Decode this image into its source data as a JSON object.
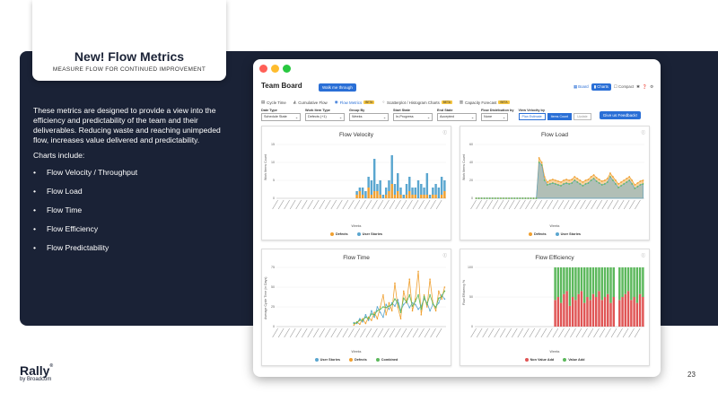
{
  "slide": {
    "title": "New! Flow Metrics",
    "subtitle": "MEASURE FLOW FOR CONTINUED IMPROVEMENT",
    "intro": "These metrics are designed to provide a view into the efficiency and predictability of the team and their deliverables. Reducing waste and reaching unimpeded flow, increases value delivered and predictability.",
    "charts_include": "Charts include:",
    "bullets": [
      "Flow Velocity / Throughput",
      "Flow Load",
      "Flow Time",
      "Flow Efficiency",
      "Flow Predictability"
    ],
    "logo": "Rally",
    "logo_mark": "®",
    "logo_by": "by Broadcom",
    "page_number": "23"
  },
  "colors": {
    "navy": "#1a2236",
    "accent": "#2a6fd6",
    "orange": "#f0a030",
    "blue": "#5aa6cf",
    "green": "#5cb85c",
    "red": "#e05555"
  },
  "app": {
    "window_dots": [
      "#ff5f57",
      "#febc2e",
      "#28c840"
    ],
    "title": "Team Board",
    "walk_button": "Walk me through",
    "view_board": "Board",
    "view_charts": "Charts",
    "view_compact": "Compact",
    "tabs": [
      {
        "icon": "cycle-time-icon",
        "label": "Cycle Time",
        "beta": ""
      },
      {
        "icon": "cumulative-flow-icon",
        "label": "Cumulative Flow",
        "beta": ""
      },
      {
        "icon": "flow-metrics-icon",
        "label": "Flow Metrics",
        "beta": "BETA"
      },
      {
        "icon": "scatterplot-icon",
        "label": "Scatterplot / Histogram Charts",
        "beta": "BETA"
      },
      {
        "icon": "capacity-icon",
        "label": "Capacity Forecast",
        "beta": "BETA"
      }
    ],
    "filters": {
      "date_type": {
        "label": "Date Type",
        "value": "Schedule State"
      },
      "work_item_type": {
        "label": "Work Item Type",
        "value": "Defects (+1)"
      },
      "group_by": {
        "label": "Group By",
        "value": "Weeks"
      },
      "start_state": {
        "label": "Start State",
        "value": "In-Progress"
      },
      "end_state": {
        "label": "End State",
        "value": "Accepted"
      },
      "flow_dist": {
        "label": "Flow Distribution by",
        "value": "None"
      },
      "view_velocity": {
        "label": "View Velocity by",
        "btn1": "Plan Estimate",
        "btn2": "Items Count",
        "update": "Update"
      }
    },
    "feedback_button": "Give us Feedback!"
  },
  "chart_data": [
    {
      "type": "bar",
      "title": "Flow Velocity",
      "xlabel": "Weeks",
      "ylabel": "Work Items Count",
      "ylim": [
        0,
        15
      ],
      "yticks": [
        "15",
        "10",
        "5",
        "0"
      ],
      "series": [
        {
          "name": "Defects",
          "color": "#f0a030",
          "values": [
            0,
            0,
            0,
            0,
            0,
            0,
            0,
            0,
            0,
            0,
            0,
            0,
            0,
            0,
            0,
            0,
            0,
            0,
            0,
            0,
            0,
            0,
            0,
            0,
            0,
            0,
            0,
            1,
            2,
            1,
            0,
            3,
            1,
            2,
            2,
            1,
            0,
            1,
            2,
            4,
            1,
            2,
            1,
            0,
            1,
            2,
            1,
            1,
            0,
            1,
            1,
            1,
            0,
            1,
            1,
            0,
            1,
            2
          ]
        },
        {
          "name": "User Stories",
          "color": "#5aa6cf",
          "values": [
            0,
            0,
            0,
            0,
            0,
            0,
            0,
            0,
            0,
            0,
            0,
            0,
            0,
            0,
            0,
            0,
            0,
            0,
            0,
            0,
            0,
            0,
            0,
            0,
            0,
            0,
            0,
            1,
            1,
            2,
            2,
            3,
            4,
            9,
            2,
            4,
            1,
            2,
            3,
            8,
            3,
            5,
            2,
            1,
            3,
            4,
            2,
            2,
            5,
            3,
            2,
            6,
            1,
            2,
            3,
            3,
            5,
            3
          ]
        }
      ]
    },
    {
      "type": "area",
      "title": "Flow Load",
      "xlabel": "Weeks",
      "ylabel": "Work Items Count",
      "ylim": [
        0,
        60
      ],
      "yticks": [
        "60",
        "40",
        "20",
        "0"
      ],
      "series": [
        {
          "name": "Defects",
          "color": "#f0a030",
          "values": [
            0,
            0,
            0,
            0,
            0,
            0,
            0,
            0,
            0,
            0,
            0,
            0,
            0,
            0,
            0,
            0,
            0,
            0,
            0,
            0,
            0,
            0,
            0,
            45,
            40,
            24,
            18,
            20,
            21,
            20,
            19,
            18,
            20,
            21,
            20,
            21,
            24,
            22,
            20,
            18,
            20,
            21,
            24,
            26,
            23,
            21,
            19,
            20,
            22,
            28,
            24,
            20,
            16,
            18,
            20,
            22,
            24,
            20,
            15,
            17,
            19,
            20
          ]
        },
        {
          "name": "User Stories",
          "color": "#5aa6cf",
          "values": [
            0,
            0,
            0,
            0,
            0,
            0,
            0,
            0,
            0,
            0,
            0,
            0,
            0,
            0,
            0,
            0,
            0,
            0,
            0,
            0,
            0,
            0,
            0,
            40,
            37,
            20,
            15,
            16,
            17,
            16,
            15,
            14,
            16,
            17,
            16,
            17,
            20,
            18,
            16,
            14,
            16,
            17,
            20,
            22,
            19,
            17,
            15,
            16,
            18,
            24,
            20,
            16,
            12,
            14,
            16,
            18,
            20,
            16,
            11,
            13,
            15,
            16
          ]
        }
      ]
    },
    {
      "type": "line",
      "title": "Flow Time",
      "xlabel": "Weeks",
      "ylabel": "Average Cycle Time (in Days)",
      "ylim": [
        0,
        75
      ],
      "yticks": [
        "75",
        "50",
        "25",
        "0"
      ],
      "series": [
        {
          "name": "User Stories",
          "color": "#5aa6cf",
          "values": [
            null,
            null,
            null,
            null,
            null,
            null,
            null,
            null,
            null,
            null,
            null,
            null,
            null,
            null,
            null,
            null,
            null,
            null,
            null,
            null,
            null,
            null,
            null,
            null,
            null,
            null,
            5,
            4,
            10,
            6,
            15,
            8,
            20,
            12,
            25,
            18,
            12,
            28,
            22,
            30,
            26,
            34,
            20,
            28,
            32,
            24,
            30,
            28,
            22,
            26,
            35,
            30,
            20,
            28,
            25,
            30,
            40,
            35
          ]
        },
        {
          "name": "Defects",
          "color": "#f0a030",
          "values": [
            null,
            null,
            null,
            null,
            null,
            null,
            null,
            null,
            null,
            null,
            null,
            null,
            null,
            null,
            null,
            null,
            null,
            null,
            null,
            null,
            null,
            null,
            null,
            null,
            null,
            null,
            2,
            6,
            3,
            10,
            4,
            12,
            8,
            18,
            10,
            25,
            40,
            15,
            30,
            20,
            55,
            25,
            10,
            45,
            30,
            60,
            20,
            35,
            70,
            15,
            40,
            25,
            60,
            30,
            20,
            45,
            35,
            50
          ]
        },
        {
          "name": "Combined",
          "color": "#5cb85c",
          "values": [
            null,
            null,
            null,
            null,
            null,
            null,
            null,
            null,
            null,
            null,
            null,
            null,
            null,
            null,
            null,
            null,
            null,
            null,
            null,
            null,
            null,
            null,
            null,
            null,
            null,
            null,
            4,
            5,
            8,
            8,
            12,
            10,
            16,
            15,
            20,
            22,
            25,
            24,
            26,
            28,
            35,
            30,
            18,
            36,
            31,
            40,
            26,
            32,
            40,
            22,
            38,
            28,
            40,
            29,
            24,
            36,
            38,
            45
          ]
        }
      ]
    },
    {
      "type": "bar",
      "title": "Flow Efficiency",
      "xlabel": "Weeks",
      "ylabel": "Flow Efficiency %",
      "ylim": [
        0,
        100
      ],
      "yticks": [
        "100",
        "50",
        "0"
      ],
      "series": [
        {
          "name": "Non Value Add",
          "color": "#e05555",
          "values": [
            0,
            0,
            0,
            0,
            0,
            0,
            0,
            0,
            0,
            0,
            0,
            0,
            0,
            0,
            0,
            0,
            0,
            0,
            0,
            0,
            0,
            0,
            0,
            0,
            0,
            0,
            0,
            45,
            50,
            40,
            55,
            60,
            35,
            50,
            45,
            55,
            60,
            40,
            50,
            45,
            55,
            50,
            60,
            45,
            50,
            55,
            40,
            50,
            0,
            45,
            50,
            55,
            60,
            45,
            50,
            40,
            55,
            50
          ]
        },
        {
          "name": "Value Add",
          "color": "#5cb85c",
          "values": [
            0,
            0,
            0,
            0,
            0,
            0,
            0,
            0,
            0,
            0,
            0,
            0,
            0,
            0,
            0,
            0,
            0,
            0,
            0,
            0,
            0,
            0,
            0,
            0,
            0,
            0,
            0,
            55,
            50,
            60,
            45,
            40,
            65,
            50,
            55,
            45,
            40,
            60,
            50,
            55,
            45,
            50,
            40,
            55,
            50,
            45,
            60,
            50,
            0,
            55,
            50,
            45,
            40,
            55,
            50,
            60,
            45,
            50
          ]
        }
      ]
    }
  ]
}
